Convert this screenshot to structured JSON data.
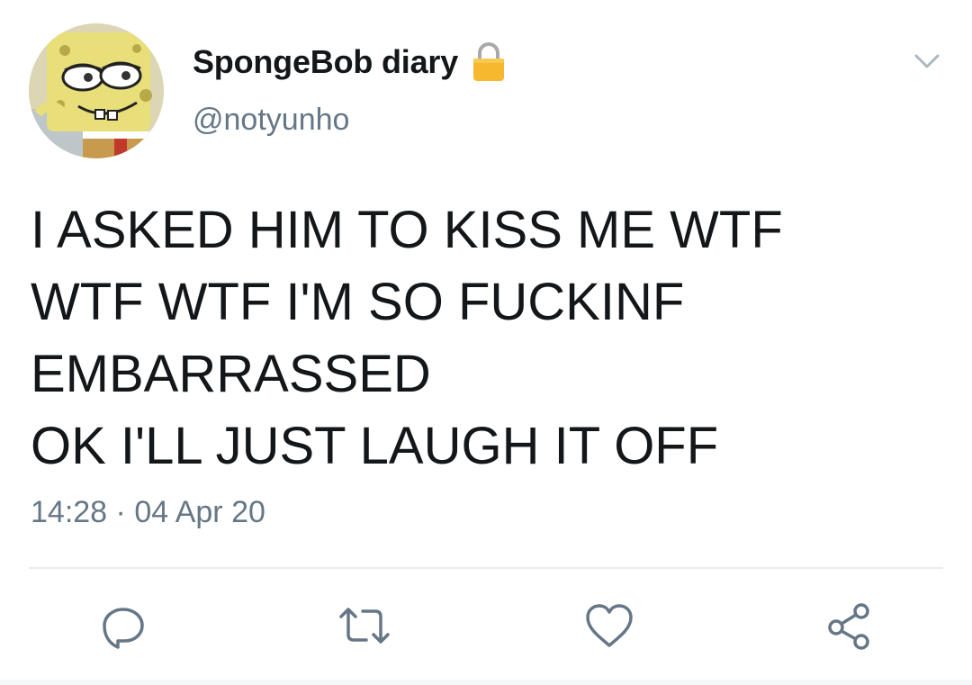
{
  "author": {
    "display_name": "SpongeBob diary",
    "handle": "@notyunho",
    "protected": true,
    "avatar_icon": "spongebob-avatar"
  },
  "tweet": {
    "lines": [
      "I ASKED HIM TO KISS ME WTF",
      "WTF WTF I'M SO FUCKINF",
      "EMBARRASSED",
      "OK I'LL JUST LAUGH IT OFF"
    ],
    "time": "14:28",
    "separator": "·",
    "date": "04 Apr 20"
  },
  "actions": [
    {
      "name": "reply",
      "icon": "reply-icon"
    },
    {
      "name": "retweet",
      "icon": "retweet-icon"
    },
    {
      "name": "like",
      "icon": "heart-icon"
    },
    {
      "name": "share",
      "icon": "share-icon"
    }
  ],
  "colors": {
    "text": "#14171a",
    "secondary": "#657786",
    "divider": "#e6ecf0",
    "lock": "#f5b82e"
  }
}
